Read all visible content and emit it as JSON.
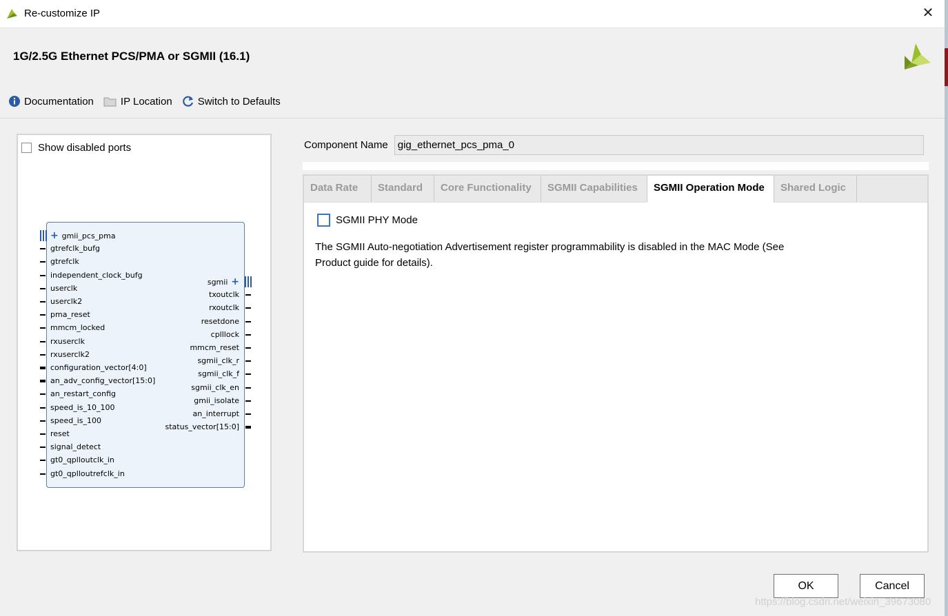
{
  "window": {
    "title": "Re-customize IP",
    "close_glyph": "✕"
  },
  "header": {
    "ip_title": "1G/2.5G Ethernet PCS/PMA or SGMII (16.1)",
    "toolbar": [
      {
        "label": "Documentation",
        "icon": "info-icon"
      },
      {
        "label": "IP Location",
        "icon": "folder-icon"
      },
      {
        "label": "Switch to Defaults",
        "icon": "refresh-icon"
      }
    ]
  },
  "left_panel": {
    "show_disabled_label": "Show disabled ports",
    "show_disabled_checked": false,
    "symbol": {
      "left_ports": [
        {
          "name": "gmii_pcs_pma",
          "type": "interface"
        },
        {
          "name": "gtrefclk_bufg",
          "type": "wire"
        },
        {
          "name": "gtrefclk",
          "type": "wire"
        },
        {
          "name": "independent_clock_bufg",
          "type": "wire"
        },
        {
          "name": "userclk",
          "type": "wire"
        },
        {
          "name": "userclk2",
          "type": "wire"
        },
        {
          "name": "pma_reset",
          "type": "wire"
        },
        {
          "name": "mmcm_locked",
          "type": "wire"
        },
        {
          "name": "rxuserclk",
          "type": "wire"
        },
        {
          "name": "rxuserclk2",
          "type": "wire"
        },
        {
          "name": "configuration_vector[4:0]",
          "type": "bus"
        },
        {
          "name": "an_adv_config_vector[15:0]",
          "type": "bus"
        },
        {
          "name": "an_restart_config",
          "type": "wire"
        },
        {
          "name": "speed_is_10_100",
          "type": "wire"
        },
        {
          "name": "speed_is_100",
          "type": "wire"
        },
        {
          "name": "reset",
          "type": "wire"
        },
        {
          "name": "signal_detect",
          "type": "wire"
        },
        {
          "name": "gt0_qplloutclk_in",
          "type": "wire"
        },
        {
          "name": "gt0_qplloutrefclk_in",
          "type": "wire"
        }
      ],
      "right_ports": [
        {
          "name": "sgmii",
          "type": "interface"
        },
        {
          "name": "txoutclk",
          "type": "wire"
        },
        {
          "name": "rxoutclk",
          "type": "wire"
        },
        {
          "name": "resetdone",
          "type": "wire"
        },
        {
          "name": "cplllock",
          "type": "wire"
        },
        {
          "name": "mmcm_reset",
          "type": "wire"
        },
        {
          "name": "sgmii_clk_r",
          "type": "wire"
        },
        {
          "name": "sgmii_clk_f",
          "type": "wire"
        },
        {
          "name": "sgmii_clk_en",
          "type": "wire"
        },
        {
          "name": "gmii_isolate",
          "type": "wire"
        },
        {
          "name": "an_interrupt",
          "type": "wire"
        },
        {
          "name": "status_vector[15:0]",
          "type": "bus"
        }
      ]
    }
  },
  "main": {
    "component_name_label": "Component Name",
    "component_name_value": "gig_ethernet_pcs_pma_0",
    "tabs": [
      {
        "label": "Data Rate",
        "active": false
      },
      {
        "label": "Standard",
        "active": false
      },
      {
        "label": "Core Functionality",
        "active": false
      },
      {
        "label": "SGMII Capabilities",
        "active": false
      },
      {
        "label": "SGMII Operation Mode",
        "active": true
      },
      {
        "label": "Shared Logic",
        "active": false
      }
    ],
    "sgmii_phy_mode_label": "SGMII PHY Mode",
    "sgmii_phy_mode_checked": false,
    "description_line1": "The SGMII Auto-negotiation Advertisement register programmability is disabled in the MAC Mode (See",
    "description_line2": "Product guide for details)."
  },
  "footer": {
    "ok_label": "OK",
    "cancel_label": "Cancel"
  },
  "watermark": "https://blog.csdn.net/weixin_39673080",
  "colors": {
    "accent_blue": "#3b74c4",
    "symbol_fill": "#edf3fa",
    "symbol_border": "#5b7ea6",
    "xilinx_green": "#9bbf2a"
  }
}
